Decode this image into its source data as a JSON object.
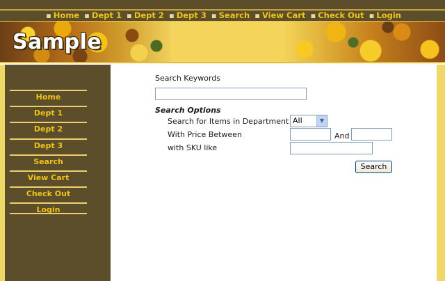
{
  "nav": {
    "items": [
      "Home",
      "Dept 1",
      "Dept 2",
      "Dept 3",
      "Search",
      "View Cart",
      "Check Out",
      "Login"
    ]
  },
  "banner": {
    "logo_text": "Sample"
  },
  "sidebar": {
    "items": [
      "Home",
      "Dept 1",
      "Dept 2",
      "Dept 3",
      "Search",
      "View Cart",
      "Check Out",
      "Login"
    ]
  },
  "search": {
    "keywords_label": "Search Keywords",
    "keywords_value": "",
    "options_title": "Search Options",
    "department_label": "Search for Items in Department",
    "department_selected": "All",
    "price_label": "With Price Between",
    "price_from_value": "",
    "and_label": "And",
    "price_to_value": "",
    "sku_label": "with SKU like",
    "sku_value": "",
    "button_label": "Search"
  },
  "colors": {
    "dark_olive": "#5c4e2a",
    "nav_text": "#f0c419",
    "gold_bg": "#efd866"
  }
}
